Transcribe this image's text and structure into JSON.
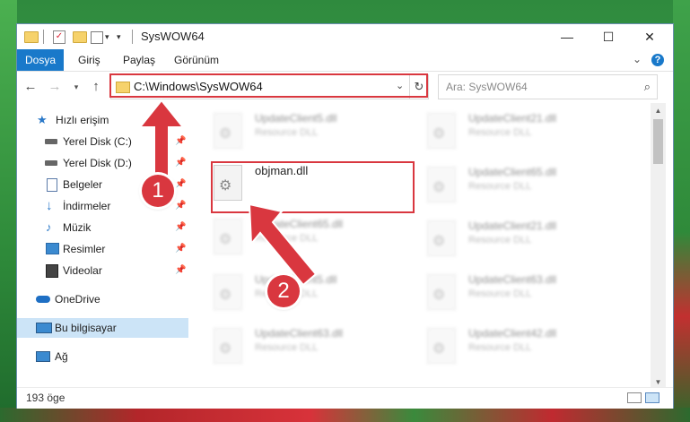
{
  "titlebar": {
    "title": "SysWOW64",
    "minimize_glyph": "—",
    "maximize_glyph": "☐",
    "close_glyph": "✕"
  },
  "ribbon": {
    "tabs": [
      "Dosya",
      "Giriş",
      "Paylaş",
      "Görünüm"
    ],
    "help": "?"
  },
  "address": {
    "path": "C:\\Windows\\SysWOW64",
    "search_placeholder": "Ara: SysWOW64"
  },
  "navpane": {
    "items": [
      {
        "label": "Hızlı erişim",
        "icon": "star-icon",
        "pinned": false
      },
      {
        "label": "Yerel Disk (C:)",
        "icon": "drive-icon",
        "pinned": true
      },
      {
        "label": "Yerel Disk (D:)",
        "icon": "drive-icon",
        "pinned": true
      },
      {
        "label": "Belgeler",
        "icon": "documents-icon",
        "pinned": true
      },
      {
        "label": "İndirmeler",
        "icon": "download-icon",
        "pinned": true
      },
      {
        "label": "Müzik",
        "icon": "music-icon",
        "pinned": true
      },
      {
        "label": "Resimler",
        "icon": "pictures-icon",
        "pinned": true
      },
      {
        "label": "Videolar",
        "icon": "videos-icon",
        "pinned": true
      },
      {
        "label": "OneDrive",
        "icon": "cloud-icon",
        "pinned": false
      },
      {
        "label": "Bu bilgisayar",
        "icon": "computer-icon",
        "pinned": false
      },
      {
        "label": "Ağ",
        "icon": "network-icon",
        "pinned": false
      }
    ]
  },
  "files": {
    "highlighted": {
      "name": "objman.dll"
    },
    "left_column": [
      {
        "name": "UpdateClient5.dll",
        "type": "Resource DLL"
      },
      {
        "name": "UpdateClient65.dll",
        "type": "Resource DLL"
      },
      {
        "name": "UpdateClient5.dll",
        "type": "Resource DLL"
      },
      {
        "name": "UpdateClient63.dll",
        "type": "Resource DLL"
      }
    ],
    "right_column": [
      {
        "name": "UpdateClient21.dll",
        "type": "Resource DLL"
      },
      {
        "name": "UpdateClient65.dll",
        "type": "Resource DLL"
      },
      {
        "name": "UpdateClient21.dll",
        "type": "Resource DLL"
      },
      {
        "name": "UpdateClient63.dll",
        "type": "Resource DLL"
      },
      {
        "name": "UpdateClient42.dll",
        "type": "Resource DLL"
      }
    ]
  },
  "status": {
    "count": "193 öge"
  },
  "annotations": {
    "badge1": "1",
    "badge2": "2",
    "color": "#d9373f"
  }
}
